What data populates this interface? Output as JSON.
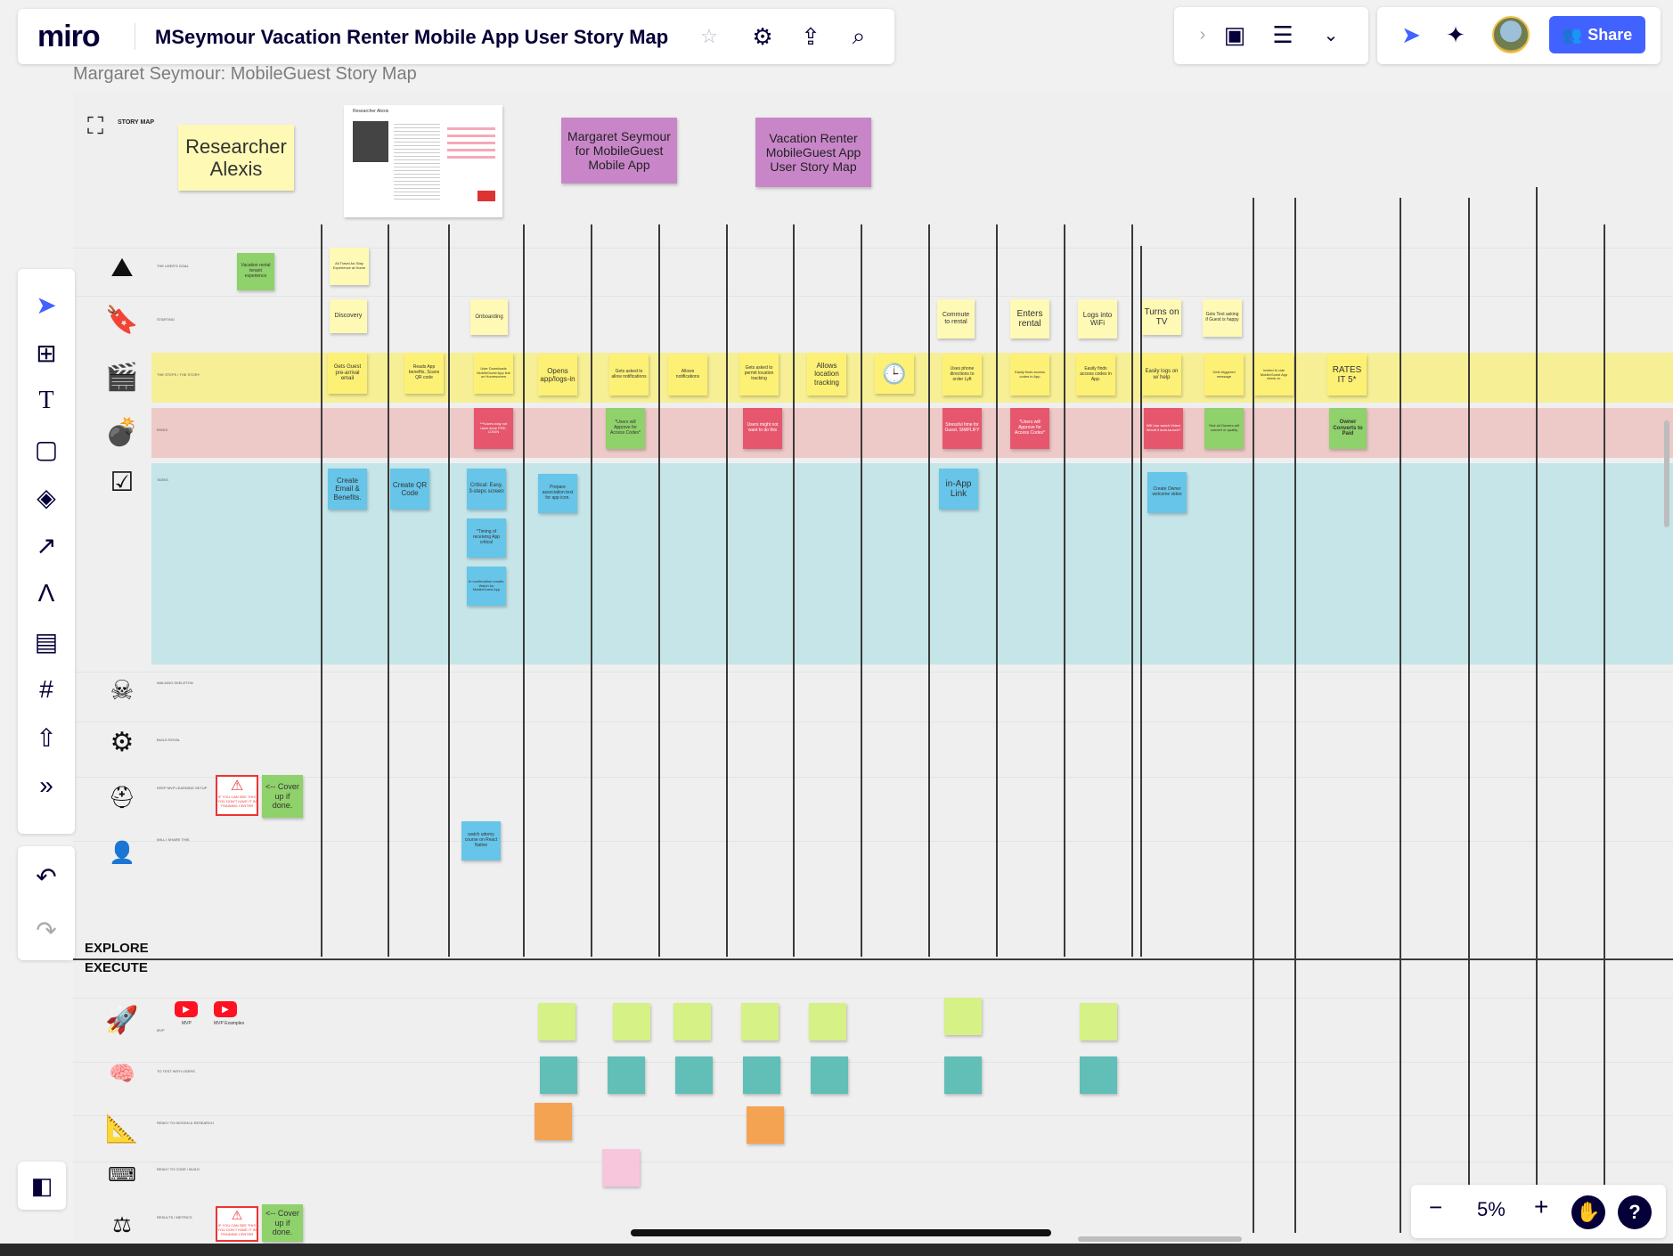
{
  "app": {
    "name": "miro",
    "board_title": "MSeymour Vacation Renter Mobile App User Story Map"
  },
  "frame": {
    "title": "Margaret Seymour: MobileGuest Story Map"
  },
  "header_tools": {
    "share_label": "Share"
  },
  "zoom": {
    "level": "5%"
  },
  "board": {
    "storymap_label": "STORY MAP",
    "researcher_sticky": "Researcher Alexis",
    "doc_thumb_title": "Researcher Alexis",
    "purple_notes": [
      "Margaret Seymour for MobileGuest Mobile App",
      "Vacation Renter MobileGuest App User Story Map"
    ],
    "explore_label": "EXPLORE",
    "execute_label": "EXECUTE",
    "row_labels": [
      "THE USER'S GOAL",
      "STARTING",
      "THE STEPS / THE STORY",
      "RISKS",
      "TASKS",
      "WALKING SKELETON",
      "BUILD ROYAL",
      "KEEP MVP LEARNING SETUP",
      "WILL I SHARE THIS",
      "MVP",
      "TO TEST WITH USERS",
      "READY TO DESIGN & RESEARCH",
      "READY TO CODE / BUILD",
      "RESULTS / METRICS"
    ],
    "stickies": {
      "goal_green": "Vacation rental tenant experience",
      "goal1": "All Travel-for-Stay Experience at Home",
      "starting": [
        "Discovery",
        "Onboarding",
        "Commute to rental",
        "Enters rental",
        "Logs into WiFi",
        "Turns on TV",
        "Gets Text asking if Guest is happy"
      ],
      "steps": [
        "Gets Guest pre-arrival email",
        "Reads App benefits, Scans QR code",
        "User Downloads MobileGuest App link on Homescreen",
        "Opens app/logs-in",
        "Gets asked to allow notifications",
        "Allows notifications",
        "Gets asked to permit location tracking",
        "Allows location tracking",
        "Uses phone directions to order Lyft",
        "Easily finds access codes in App",
        "Easily finds access codes in App.",
        "Easily logs on w/ help",
        "Gets triggered message",
        "Invited to rate MobileGuest App check-in.",
        "RATES IT 5*"
      ],
      "risks": [
        "***Users may not have done PRE-LOGIN",
        "*Users will Approve for Access Codes*",
        "Users might not want to do this",
        "Stressful time for Guest. SIMPLIFY",
        "*Users will Approve for Access Codes*",
        "Will Use watch Video/ Would it auto-launch?",
        "*Not all Owners will convert or qualify",
        "Owner Converts to Paid"
      ],
      "tasks": [
        "Create Email & Benefits.",
        "Create QR Code",
        "Critical: Easy, 3-steps screen",
        "*Timing of receiving App critical",
        "In confirmation emails: Watch for MobileGuest App",
        "Prepare association text for app icon.",
        "in-App Link",
        "Create Owner welcome video"
      ],
      "warn_text": "IF YOU CAN SEE THIS YOU DON'T HAVE IT IN TRAINING CENTER",
      "cover_up": "<-- Cover up if done.",
      "react_native": "watch udemy course on React Native",
      "mvp_yt": [
        "MVP",
        "MVP Examples"
      ]
    }
  },
  "colors": {
    "accent": "#4262ff",
    "yellow_band": "#f7ef95",
    "red_band": "#edc9c8",
    "teal_band": "#c5e5e8"
  }
}
